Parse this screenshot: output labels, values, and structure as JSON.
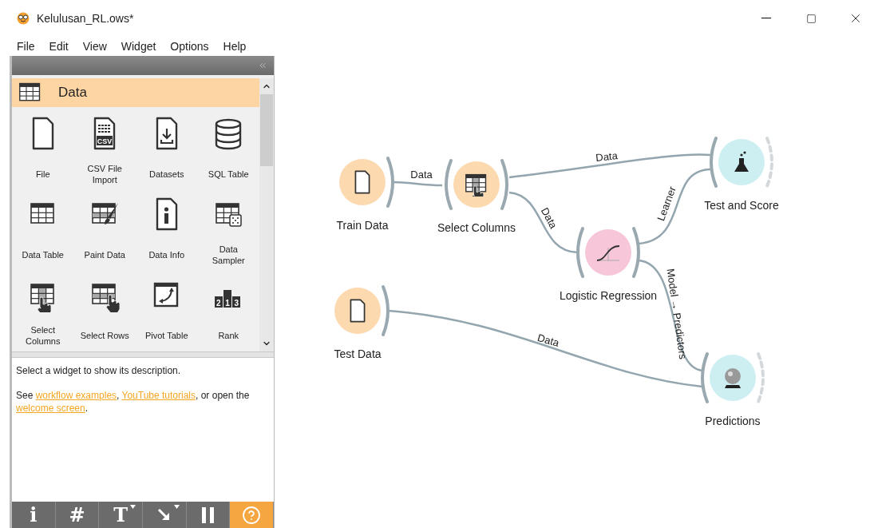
{
  "window": {
    "title": "Kelulusan_RL.ows*"
  },
  "menu": [
    "File",
    "Edit",
    "View",
    "Widget",
    "Options",
    "Help"
  ],
  "toolbox": {
    "category": "Data",
    "widgets": [
      {
        "label": "File",
        "kind": "file"
      },
      {
        "label": "CSV File Import",
        "kind": "csv",
        "icon_text": "CSV"
      },
      {
        "label": "Datasets",
        "kind": "datasets"
      },
      {
        "label": "SQL Table",
        "kind": "sql"
      },
      {
        "label": "Data Table",
        "kind": "table"
      },
      {
        "label": "Paint Data",
        "kind": "paint"
      },
      {
        "label": "Data Info",
        "kind": "info"
      },
      {
        "label": "Data Sampler",
        "kind": "sampler"
      },
      {
        "label": "Select Columns",
        "kind": "select-columns"
      },
      {
        "label": "Select Rows",
        "kind": "select-rows"
      },
      {
        "label": "Pivot Table",
        "kind": "pivot"
      },
      {
        "label": "Rank",
        "kind": "rank",
        "icon_text": "2 1 3"
      }
    ]
  },
  "description": {
    "text": "Select a widget to show its description.",
    "help": [
      {
        "kind": "text",
        "text": "See "
      },
      {
        "kind": "link",
        "text": "workflow examples"
      },
      {
        "kind": "text",
        "text": ", "
      },
      {
        "kind": "link",
        "text": "YouTube tutorials"
      },
      {
        "kind": "text",
        "text": ", or open the "
      },
      {
        "kind": "link",
        "text": "welcome screen"
      },
      {
        "kind": "text",
        "text": "."
      }
    ]
  },
  "toolbar": [
    {
      "kind": "glyph",
      "glyph": "i",
      "menu": false,
      "selected": false
    },
    {
      "kind": "glyph",
      "glyph": "#",
      "menu": false,
      "selected": false
    },
    {
      "kind": "glyph",
      "glyph": "T",
      "menu": true,
      "selected": false
    },
    {
      "kind": "arrow",
      "menu": true,
      "selected": false
    },
    {
      "kind": "pause",
      "menu": false,
      "selected": false
    },
    {
      "kind": "help",
      "menu": false,
      "selected": true
    }
  ],
  "canvas": {
    "nodes": [
      {
        "label": "Train Data",
        "kind": "file",
        "color": "#fcd9ae"
      },
      {
        "label": "Select Columns",
        "kind": "select-columns",
        "color": "#fcd9ae"
      },
      {
        "label": "Test and Score",
        "kind": "test-score",
        "color": "#cdeff2"
      },
      {
        "label": "Logistic Regression",
        "kind": "logistic-regression",
        "color": "#f7c6d8"
      },
      {
        "label": "Test Data",
        "kind": "file",
        "color": "#fcd9ae"
      },
      {
        "label": "Predictions",
        "kind": "predictions",
        "color": "#cdeff2"
      }
    ],
    "links": [
      {
        "label": "Data"
      },
      {
        "label": "Data"
      },
      {
        "label": "Data"
      },
      {
        "label": "Learner"
      },
      {
        "label": "Model → Predictors"
      },
      {
        "label": "Data"
      }
    ]
  }
}
